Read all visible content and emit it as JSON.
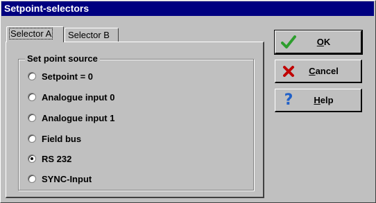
{
  "window": {
    "title": "Setpoint-selectors"
  },
  "tabs": [
    {
      "label": "Selector A",
      "active": true
    },
    {
      "label": "Selector B",
      "active": false
    }
  ],
  "group": {
    "title": "Set point source",
    "options": [
      {
        "label": "Setpoint = 0",
        "selected": false
      },
      {
        "label": "Analogue input 0",
        "selected": false
      },
      {
        "label": "Analogue input 1",
        "selected": false
      },
      {
        "label": "Field bus",
        "selected": false
      },
      {
        "label": "RS 232",
        "selected": true
      },
      {
        "label": "SYNC-Input",
        "selected": false
      }
    ]
  },
  "buttons": {
    "ok": {
      "mnemonic": "O",
      "rest": "K",
      "icon": "checkmark-icon"
    },
    "cancel": {
      "mnemonic": "C",
      "rest": "ancel",
      "icon": "x-icon"
    },
    "help": {
      "mnemonic": "H",
      "rest": "elp",
      "icon": "question-icon"
    }
  },
  "colors": {
    "titlebar": "#000080",
    "check": "#2e9e2e",
    "cancel_x": "#c00000",
    "help_q": "#2060c8"
  }
}
